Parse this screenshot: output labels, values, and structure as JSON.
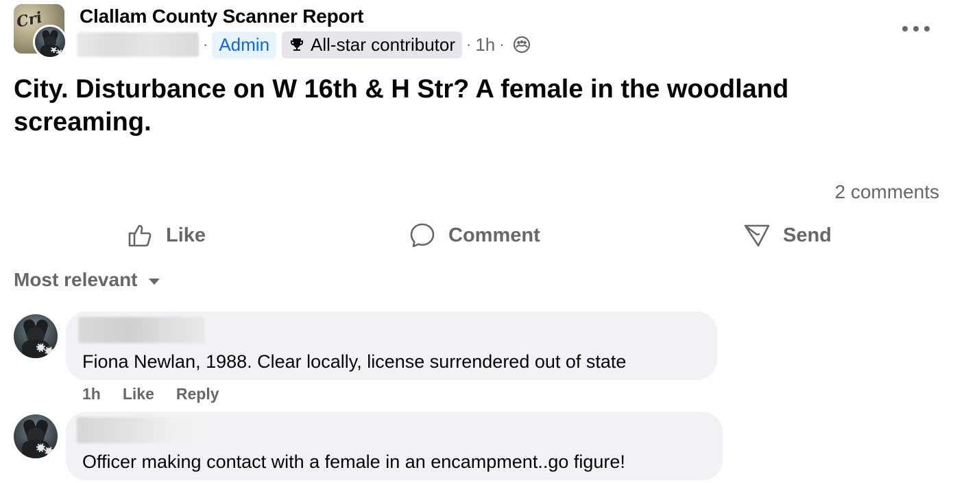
{
  "post": {
    "group_name": "Clallam County Scanner Report",
    "badge_admin": "Admin",
    "badge_allstar": "All-star contributor",
    "time": "1h",
    "text": "City. Disturbance on W 16th & H Str? A female in the woodland screaming.",
    "comments_count": "2 comments"
  },
  "group_avatar_text": "Cri",
  "actions": {
    "like": "Like",
    "comment": "Comment",
    "send": "Send"
  },
  "sort_label": "Most relevant",
  "comments": [
    {
      "text": "Fiona Newlan, 1988. Clear locally, license surrendered out of state",
      "time": "1h",
      "like": "Like",
      "reply": "Reply"
    },
    {
      "text": "Officer making contact with a female in an encampment..go figure!"
    }
  ],
  "icons": {
    "more": "more-options-icon",
    "trophy": "trophy-icon",
    "privacy": "group-members-icon",
    "like": "thumbs-up-icon",
    "comment": "speech-bubble-icon",
    "send": "send-icon",
    "sort": "caret-down-icon"
  }
}
